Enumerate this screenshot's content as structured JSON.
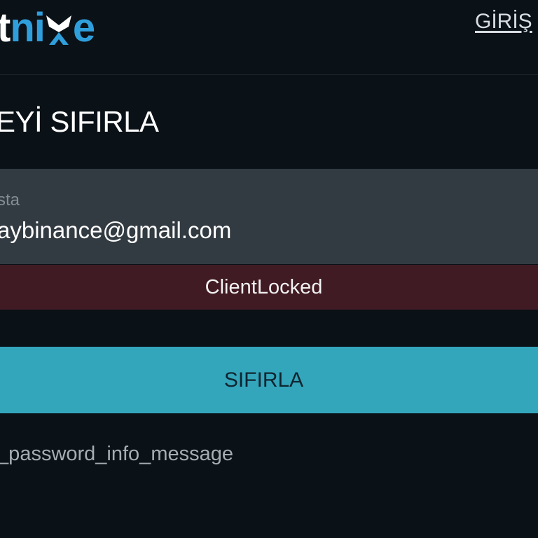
{
  "header": {
    "logo_part_a": "t",
    "logo_part_b": "ni",
    "logo_part_c": "e",
    "login_link": "GİRİŞ"
  },
  "main": {
    "title": "EYİ SIFIRLA",
    "email": {
      "label": "sta",
      "value": "aybinance@gmail.com"
    },
    "error_message": "ClientLocked",
    "reset_button": "SIFIRLA",
    "info_message": "t_password_info_message"
  },
  "colors": {
    "background": "#0a1117",
    "accent": "#33a6bc",
    "logo_blue": "#2f9fdc",
    "error_background": "#411b24",
    "input_background": "#333b42"
  },
  "icons": {
    "logo_x": "x-chevron-logo-mark"
  }
}
